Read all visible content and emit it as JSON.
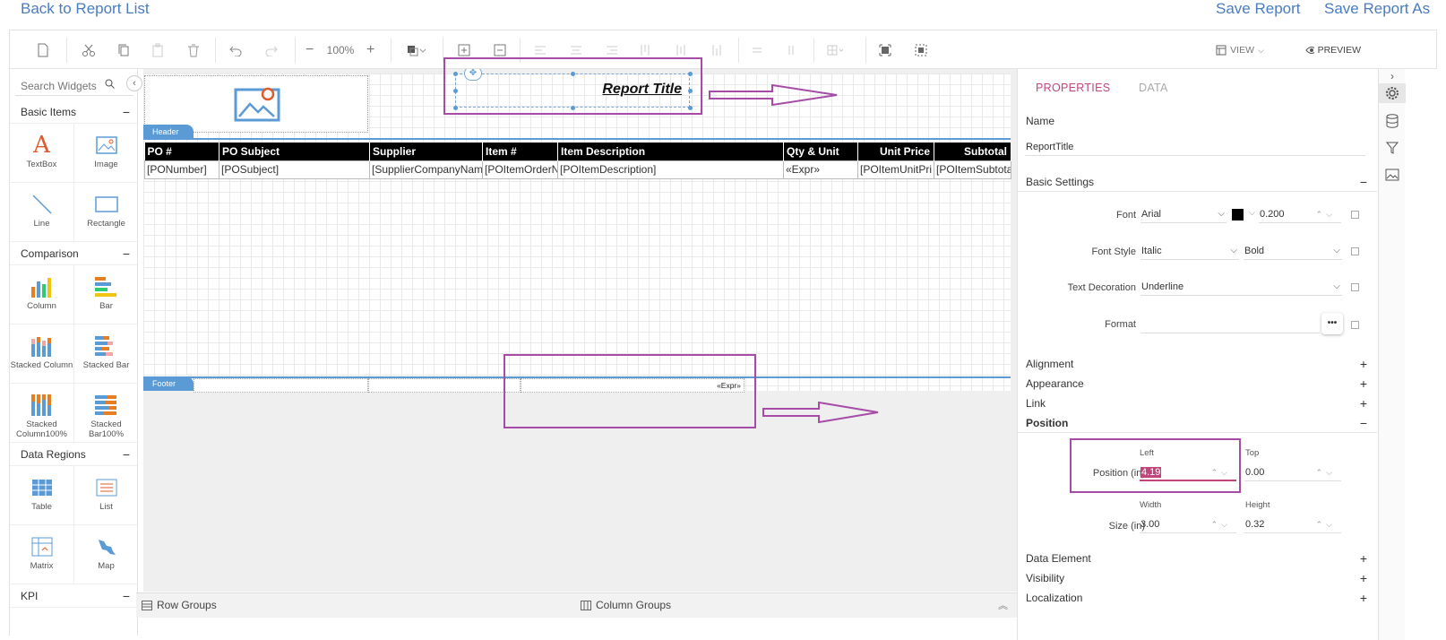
{
  "topbar": {
    "back": "Back to Report List",
    "save": "Save Report",
    "save_as": "Save Report As"
  },
  "toolbar": {
    "zoom": "100%",
    "view": "VIEW",
    "preview": "PREVIEW"
  },
  "palette": {
    "search_placeholder": "Search Widgets",
    "categories": {
      "basic": "Basic Items",
      "comparison": "Comparison",
      "data_regions": "Data Regions",
      "kpi": "KPI"
    },
    "widgets": {
      "textbox": "TextBox",
      "image": "Image",
      "line": "Line",
      "rectangle": "Rectangle",
      "column": "Column",
      "bar": "Bar",
      "stacked_column": "Stacked Column",
      "stacked_bar": "Stacked Bar",
      "stacked_column100": "Stacked Column100%",
      "stacked_bar100": "Stacked Bar100%",
      "table": "Table",
      "list": "List",
      "matrix": "Matrix",
      "map": "Map"
    }
  },
  "report": {
    "header_tag": "Header",
    "footer_tag": "Footer",
    "title": "Report Title",
    "footer_expr": "«Expr»",
    "columns": [
      "PO #",
      "PO Subject",
      "Supplier",
      "Item #",
      "Item Description",
      "Qty & Unit",
      "Unit Price",
      "Subtotal"
    ],
    "row": [
      "[PONumber]",
      "[POSubject]",
      "[SupplierCompanyNam",
      "[POItemOrderN",
      "[POItemDescription]",
      "«Expr»",
      "[POItemUnitPri",
      "[POItemSubtota"
    ]
  },
  "groups": {
    "row": "Row Groups",
    "column": "Column Groups"
  },
  "properties": {
    "tab_properties": "PROPERTIES",
    "tab_data": "DATA",
    "name_label": "Name",
    "name_value": "ReportTitle",
    "basic_settings": "Basic Settings",
    "font_label": "Font",
    "font_family": "Arial",
    "font_color": "#000000",
    "font_size": "0.200",
    "font_style_label": "Font Style",
    "font_style": "Italic",
    "font_weight": "Bold",
    "text_decoration_label": "Text Decoration",
    "text_decoration": "Underline",
    "format_label": "Format",
    "format_btn": "•••",
    "alignment": "Alignment",
    "appearance": "Appearance",
    "link": "Link",
    "position": "Position",
    "position_label": "Position (in)",
    "left_label": "Left",
    "left_value": "4.19",
    "top_label": "Top",
    "top_value": "0.00",
    "size_label": "Size (in)",
    "width_label": "Width",
    "width_value": "3.00",
    "height_label": "Height",
    "height_value": "0.32",
    "data_element": "Data Element",
    "visibility": "Visibility",
    "localization": "Localization",
    "plus": "+",
    "minus": "−"
  },
  "colors": {
    "accent": "#4a7cc1",
    "tab_active": "#c1457b",
    "annotation": "#a64ca6",
    "band": "#5b9bd5"
  }
}
